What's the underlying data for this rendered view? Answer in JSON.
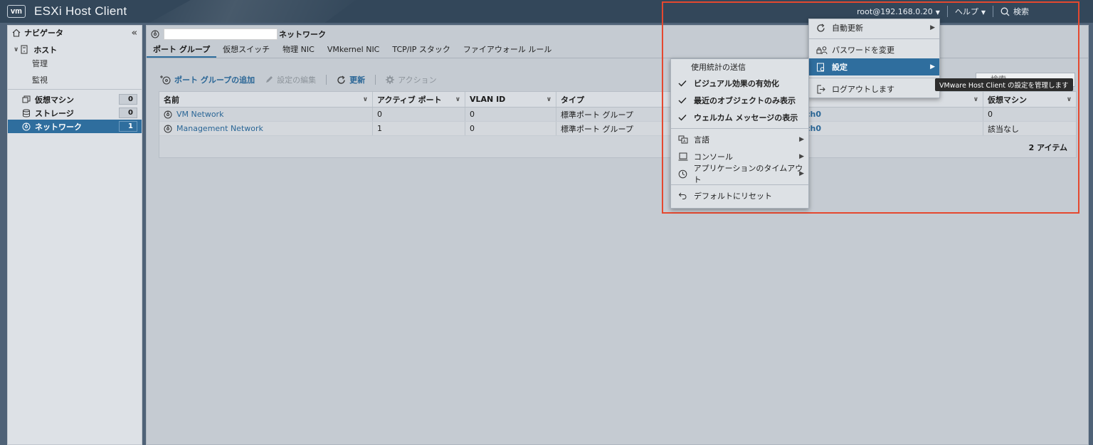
{
  "app": {
    "logo": "vm",
    "title": "ESXi Host Client"
  },
  "topbar": {
    "user": "root@192.168.0.20",
    "help": "ヘルプ",
    "search": "検索"
  },
  "navigator": {
    "title": "ナビゲータ",
    "host": "ホスト",
    "host_items": [
      "管理",
      "監視"
    ],
    "vms": {
      "label": "仮想マシン",
      "count": "0"
    },
    "storage": {
      "label": "ストレージ",
      "count": "0"
    },
    "network": {
      "label": "ネットワーク",
      "count": "1"
    }
  },
  "main": {
    "crumb_suffix": "ネットワーク",
    "tabs": [
      "ポート グループ",
      "仮想スイッチ",
      "物理 NIC",
      "VMkernel NIC",
      "TCP/IP スタック",
      "ファイアウォール ルール"
    ],
    "toolbar": {
      "add": "ポート グループの追加",
      "edit": "設定の編集",
      "refresh": "更新",
      "actions": "アクション"
    },
    "search_placeholder": "検索",
    "table": {
      "columns": [
        "名前",
        "アクティブ ポート",
        "VLAN ID",
        "タイプ",
        "",
        "仮想マシン"
      ],
      "rows": [
        [
          "VM Network",
          "0",
          "0",
          "標準ポート グループ",
          "ch0",
          "0"
        ],
        [
          "Management Network",
          "1",
          "0",
          "標準ポート グループ",
          "ch0",
          "該当なし"
        ]
      ],
      "footer": "2 アイテム"
    }
  },
  "user_menu": {
    "auto_refresh": "自動更新",
    "change_password": "パスワードを変更",
    "settings": "設定",
    "logout": "ログアウトします"
  },
  "settings_menu": {
    "heading": "使用統計の送信",
    "visual": "ビジュアル効果の有効化",
    "recent": "最近のオブジェクトのみ表示",
    "welcome": "ウェルカム メッセージの表示",
    "language": "言語",
    "console": "コンソール",
    "timeout": "アプリケーションのタイムアウト",
    "reset": "デフォルトにリセット"
  },
  "tooltip": "VMware Host Client の設定を管理します"
}
